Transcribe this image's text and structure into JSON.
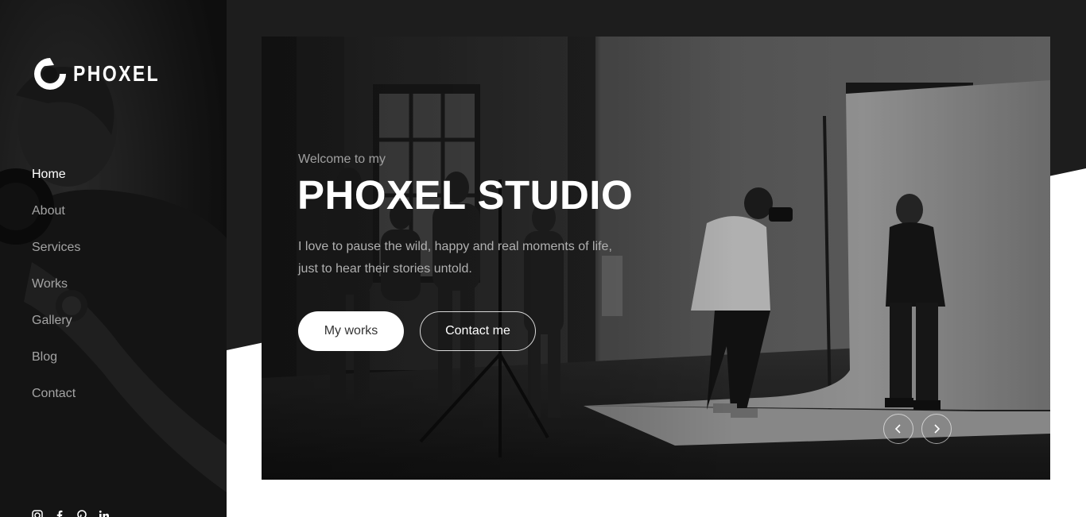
{
  "brand": {
    "name": "PHOXEL",
    "logo_icon": "phoxel-aperture-logo"
  },
  "nav": {
    "items": [
      {
        "label": "Home",
        "active": true
      },
      {
        "label": "About"
      },
      {
        "label": "Services"
      },
      {
        "label": "Works"
      },
      {
        "label": "Gallery"
      },
      {
        "label": "Blog"
      },
      {
        "label": "Contact"
      }
    ]
  },
  "socials": [
    "instagram-icon",
    "facebook-icon",
    "pinterest-icon",
    "linkedin-icon"
  ],
  "hero": {
    "eyebrow": "Welcome to my",
    "title": "PHOXEL STUDIO",
    "description": "I love to pause the wild, happy and real moments of life, just to hear their stories untold.",
    "primary_button": "My works",
    "secondary_button": "Contact me",
    "prev_icon": "chevron-left-icon",
    "next_icon": "chevron-right-icon"
  },
  "colors": {
    "sidebar_bg": "#121212",
    "band_bg": "#1d1d1d",
    "nav_active": "#ffffff",
    "nav_inactive": "#a4a4a4",
    "accent_light": "#ffffff"
  }
}
